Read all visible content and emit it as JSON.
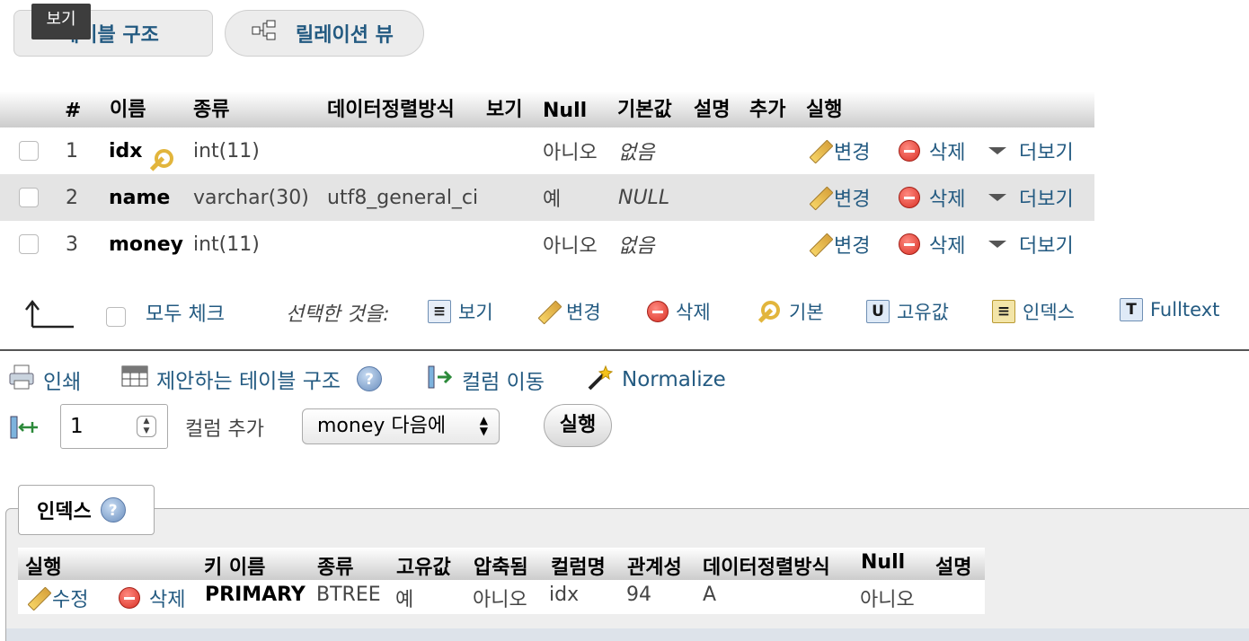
{
  "view_tabs": {
    "structure_label": "테이블 구조",
    "relation_label": "릴레이션 뷰",
    "tooltip": "보기"
  },
  "structure": {
    "headers": [
      "#",
      "이름",
      "종류",
      "데이터정렬방식",
      "보기",
      "Null",
      "기본값",
      "설명",
      "추가",
      "실행"
    ],
    "rows": [
      {
        "num": "1",
        "name": "idx",
        "type": "int(11)",
        "collation": "",
        "null": "아니오",
        "default": "없음",
        "primary": true
      },
      {
        "num": "2",
        "name": "name",
        "type": "varchar(30)",
        "collation": "utf8_general_ci",
        "null": "예",
        "default": "NULL",
        "primary": false
      },
      {
        "num": "3",
        "name": "money",
        "type": "int(11)",
        "collation": "",
        "null": "아니오",
        "default": "없음",
        "primary": false
      }
    ],
    "actions": {
      "change": "변경",
      "drop": "삭제",
      "more": "더보기"
    }
  },
  "bulk": {
    "check_all": "모두 체크",
    "with_selected": "선택한 것을:",
    "browse": "보기",
    "change": "변경",
    "drop": "삭제",
    "primary": "기본",
    "unique": "고유값",
    "index": "인덱스",
    "fulltext": "Fulltext"
  },
  "toolbar": {
    "print": "인쇄",
    "propose": "제안하는 테이블 구조",
    "move_columns": "컬럼 이동",
    "normalize": "Normalize"
  },
  "add_column": {
    "count": "1",
    "label": "컬럼 추가",
    "position": "money 다음에",
    "go": "실행"
  },
  "indexes": {
    "legend": "인덱스",
    "headers": [
      "실행",
      "키 이름",
      "종류",
      "고유값",
      "압축됨",
      "컬럼명",
      "관계성",
      "데이터정렬방식",
      "Null",
      "설명"
    ],
    "row": {
      "edit": "수정",
      "drop": "삭제",
      "key_name": "PRIMARY",
      "type": "BTREE",
      "unique": "예",
      "packed": "아니오",
      "column": "idx",
      "cardinality": "94",
      "collation": "A",
      "null": "아니오",
      "comment": ""
    }
  }
}
